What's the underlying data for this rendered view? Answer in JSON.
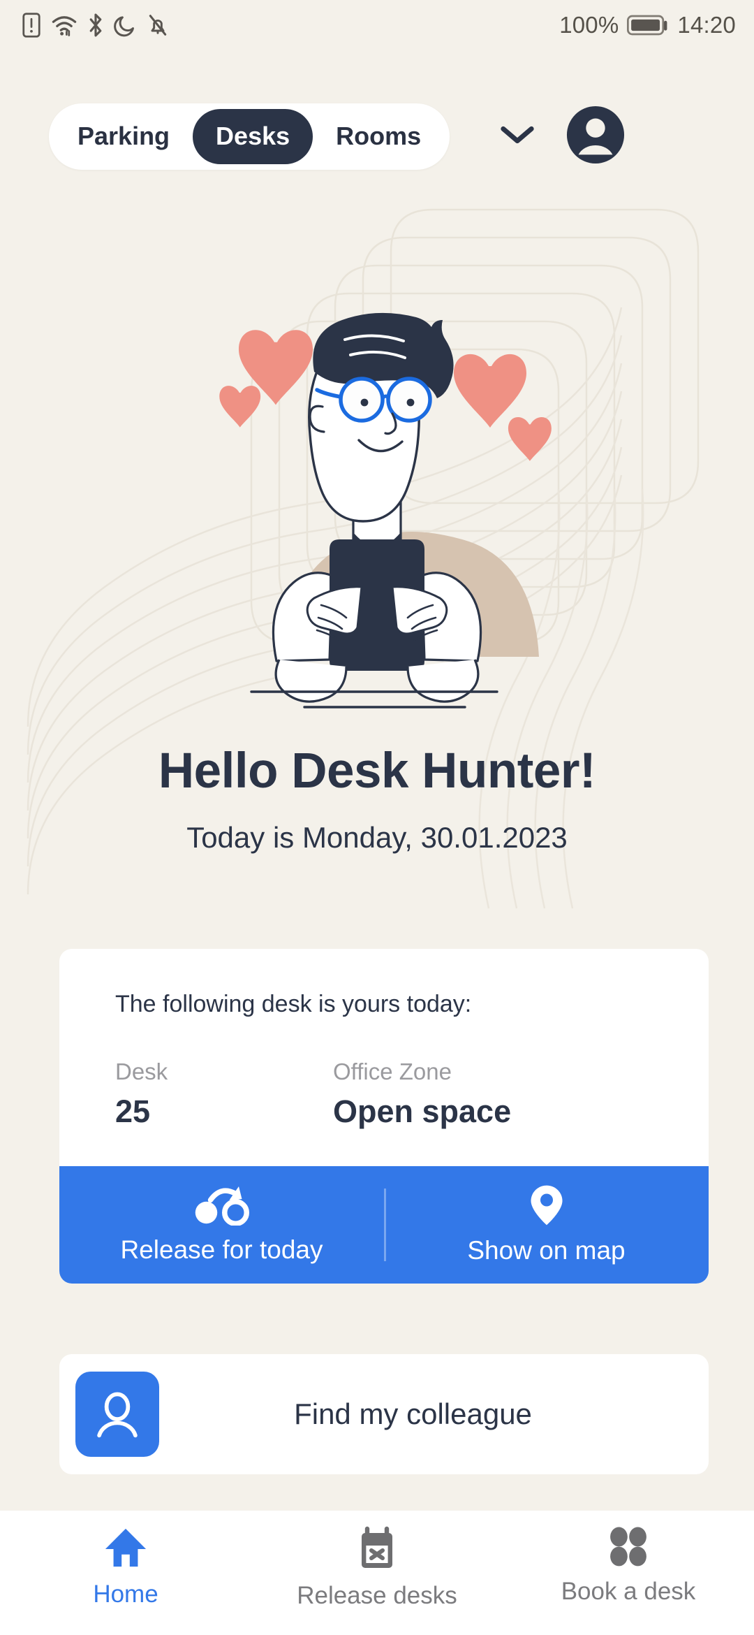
{
  "status_bar": {
    "icons": [
      "sim-alert-icon",
      "wifi-icon",
      "bluetooth-icon",
      "do-not-disturb-icon",
      "notifications-muted-icon"
    ],
    "battery_percent": "100%",
    "battery_icon": "battery-full-icon",
    "time": "14:20"
  },
  "header": {
    "tabs": [
      {
        "label": "Parking",
        "active": false
      },
      {
        "label": "Desks",
        "active": true
      },
      {
        "label": "Rooms",
        "active": false
      }
    ],
    "chevron_icon": "chevron-down-icon",
    "avatar_icon": "account-avatar-icon"
  },
  "hero": {
    "illustration_name": "person-holding-phone-with-hearts-illustration"
  },
  "greeting": {
    "title": "Hello Desk Hunter!",
    "subtitle": "Today is Monday, 30.01.2023"
  },
  "desk_card": {
    "lead": "The following desk is yours today:",
    "fields": [
      {
        "label": "Desk",
        "value": "25"
      },
      {
        "label": "Office Zone",
        "value": "Open space"
      }
    ],
    "actions": [
      {
        "label": "Release for today",
        "icon": "release-transfer-icon"
      },
      {
        "label": "Show on map",
        "icon": "map-pin-icon"
      }
    ]
  },
  "colleague_row": {
    "label": "Find my colleague",
    "icon": "person-outline-icon"
  },
  "bottom_nav": [
    {
      "label": "Home",
      "icon": "home-icon",
      "active": true
    },
    {
      "label": "Release desks",
      "icon": "calendar-x-icon",
      "active": false
    },
    {
      "label": "Book a desk",
      "icon": "grid-dots-icon",
      "active": false
    }
  ],
  "colors": {
    "background": "#F4F1EA",
    "accent_blue": "#3378E8",
    "dark_navy": "#2B3447",
    "heart_salmon": "#EF9184",
    "shirt_beige": "#D6C3B0",
    "card_white": "#FFFFFF",
    "muted_text": "#9A9A9E"
  }
}
